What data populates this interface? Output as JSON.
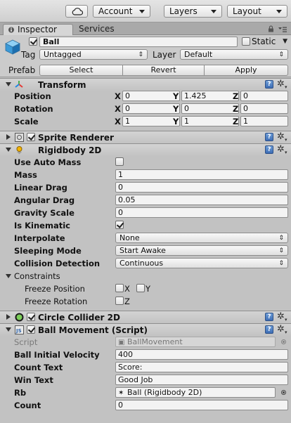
{
  "toolbar": {
    "account_label": "Account",
    "layers_label": "Layers",
    "layout_label": "Layout"
  },
  "tabs": {
    "inspector": "Inspector",
    "services": "Services"
  },
  "object": {
    "name": "Ball",
    "static_label": "Static",
    "tag_label": "Tag",
    "tag_value": "Untagged",
    "layer_label": "Layer",
    "layer_value": "Default",
    "prefab_label": "Prefab",
    "prefab_buttons": [
      "Select",
      "Revert",
      "Apply"
    ]
  },
  "transform": {
    "title": "Transform",
    "rows": [
      {
        "label": "Position",
        "x": "0",
        "y": "1.425",
        "z": "0"
      },
      {
        "label": "Rotation",
        "x": "0",
        "y": "0",
        "z": "0"
      },
      {
        "label": "Scale",
        "x": "1",
        "y": "1",
        "z": "1"
      }
    ],
    "axis_labels": [
      "X",
      "Y",
      "Z"
    ]
  },
  "sprite_renderer": {
    "title": "Sprite Renderer"
  },
  "rigidbody": {
    "title": "Rigidbody 2D",
    "use_auto_mass_label": "Use Auto Mass",
    "mass_label": "Mass",
    "mass_value": "1",
    "linear_drag_label": "Linear Drag",
    "linear_drag_value": "0",
    "angular_drag_label": "Angular Drag",
    "angular_drag_value": "0.05",
    "gravity_scale_label": "Gravity Scale",
    "gravity_scale_value": "0",
    "is_kinematic_label": "Is Kinematic",
    "interpolate_label": "Interpolate",
    "interpolate_value": "None",
    "sleeping_mode_label": "Sleeping Mode",
    "sleeping_mode_value": "Start Awake",
    "collision_detection_label": "Collision Detection",
    "collision_detection_value": "Continuous",
    "constraints_label": "Constraints",
    "freeze_position_label": "Freeze Position",
    "freeze_rotation_label": "Freeze Rotation",
    "fp_x": "X",
    "fp_y": "Y",
    "fr_z": "Z"
  },
  "circle_collider": {
    "title": "Circle Collider 2D"
  },
  "ball_movement": {
    "title": "Ball Movement (Script)",
    "script_label": "Script",
    "script_value": "BallMovement",
    "initial_velocity_label": "Ball Initial Velocity",
    "initial_velocity_value": "400",
    "count_text_label": "Count Text",
    "count_text_value": "Score:",
    "win_text_label": "Win Text",
    "win_text_value": "Good Job",
    "rb_label": "Rb",
    "rb_value": "Ball (Rigidbody 2D)",
    "count_label": "Count",
    "count_value": "0"
  }
}
